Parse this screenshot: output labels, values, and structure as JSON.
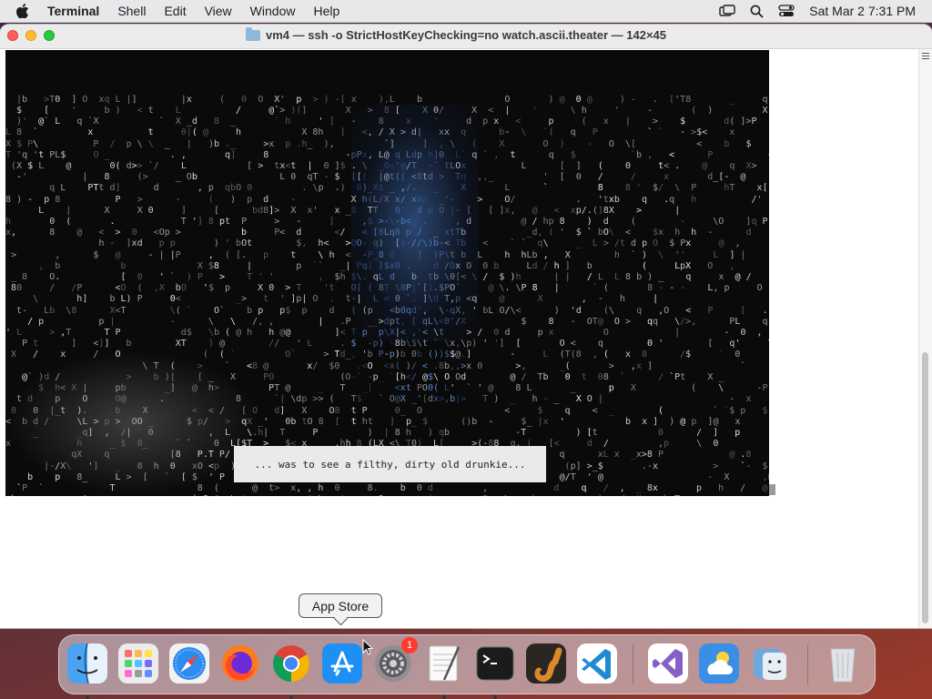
{
  "menubar": {
    "app_name": "Terminal",
    "menus": [
      "Shell",
      "Edit",
      "View",
      "Window",
      "Help"
    ],
    "datetime": "Sat Mar 2  7:31 PM"
  },
  "window": {
    "title": "vm4 — ssh -o StrictHostKeyChecking=no watch.ascii.theater — 142×45"
  },
  "terminal": {
    "subtitle": "... was to see a filthy, dirty old drunkie..."
  },
  "tooltip": {
    "label": "App Store"
  },
  "dock": {
    "items": [
      {
        "name": "Finder",
        "icon": "finder-icon",
        "running": true
      },
      {
        "name": "Launchpad",
        "icon": "launchpad-icon",
        "running": false
      },
      {
        "name": "Safari",
        "icon": "safari-icon",
        "running": false
      },
      {
        "name": "Firefox",
        "icon": "firefox-icon",
        "running": false
      },
      {
        "name": "Google Chrome",
        "icon": "chrome-icon",
        "running": true
      },
      {
        "name": "App Store",
        "icon": "app-store-icon",
        "running": false
      },
      {
        "name": "System Settings",
        "icon": "system-settings-icon",
        "running": false,
        "badge": "1"
      },
      {
        "name": "TextEdit",
        "icon": "textedit-icon",
        "running": true
      },
      {
        "name": "Terminal",
        "icon": "terminal-icon",
        "running": true
      },
      {
        "name": "GarageBand",
        "icon": "garageband-icon",
        "running": false
      },
      {
        "name": "Visual Studio Code",
        "icon": "vscode-icon",
        "running": false
      },
      {
        "name": "Visual Studio",
        "icon": "visual-studio-icon",
        "running": false
      },
      {
        "name": "Weather",
        "icon": "weather-icon",
        "running": false
      },
      {
        "name": "Migration Assistant",
        "icon": "migration-assistant-icon",
        "running": false
      },
      {
        "name": "Trash",
        "icon": "trash-icon",
        "running": false
      }
    ],
    "badge_count": "1"
  }
}
